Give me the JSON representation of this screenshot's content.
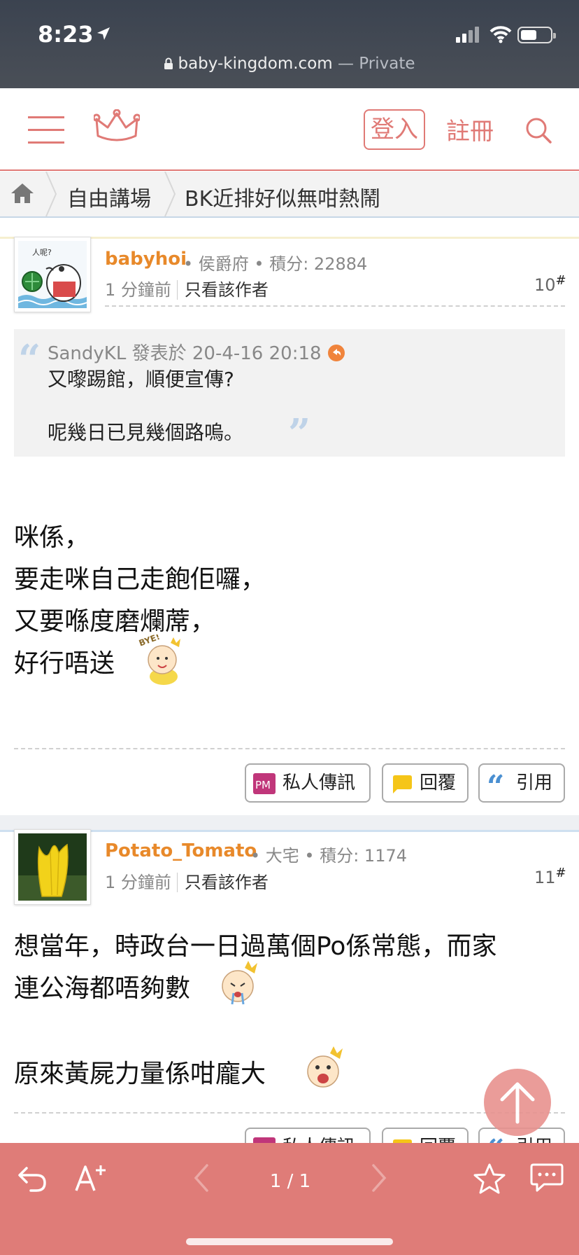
{
  "status_bar": {
    "time": "8:23",
    "url": "baby-kingdom.com",
    "url_suffix": " — Private"
  },
  "header": {
    "login_label": "登入",
    "register_label": "註冊"
  },
  "breadcrumb": {
    "items": [
      "自由講場",
      "BK近排好似無咁熱鬧"
    ]
  },
  "posts": [
    {
      "username": "babyhoi",
      "rank": "侯爵府",
      "score": "積分: 22884",
      "time": "1 分鐘前",
      "only_author": "只看該作者",
      "floor": "10",
      "quote": {
        "author_line": "SandyKL 發表於 20-4-16 20:18",
        "lines": [
          "又嚟踢館，順便宣傳?",
          "呢幾日已見幾個路嗚。"
        ]
      },
      "body": [
        "咪係，",
        "要走咪自己走飽佢囉，",
        "又要喺度磨爛蓆，",
        "好行唔送"
      ],
      "actions": {
        "pm": "私人傳訊",
        "reply": "回覆",
        "quote": "引用"
      }
    },
    {
      "username": "Potato_Tomato",
      "rank": "大宅",
      "score": "積分: 1174",
      "time": "1 分鐘前",
      "only_author": "只看該作者",
      "floor": "11",
      "body": [
        "想當年，時政台一日過萬個Po係常態，而家",
        "連公海都唔夠數",
        "原來黃屍力量係咁龐大"
      ],
      "actions": {
        "pm": "私人傳訊",
        "reply": "回覆",
        "quote": "引用"
      }
    }
  ],
  "toolbar": {
    "page_indicator": "1 / 1"
  },
  "icons": {
    "colors": {
      "accent": "#e07a76",
      "username": "#e8892a",
      "toolbar": "#df7c78"
    }
  }
}
